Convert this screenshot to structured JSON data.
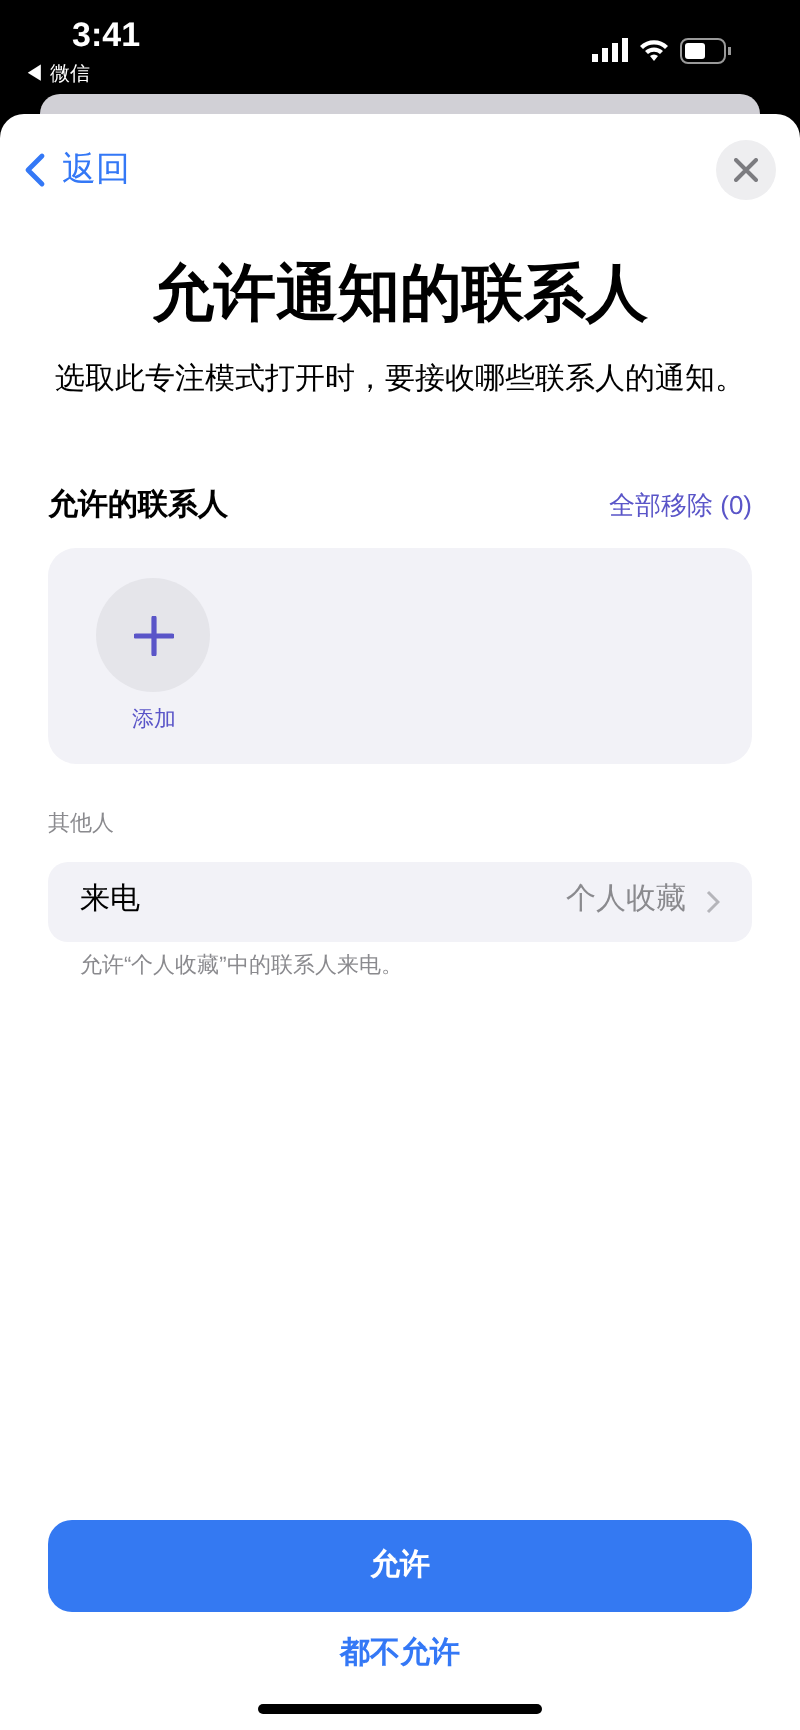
{
  "status_bar": {
    "time": "3:41",
    "back_app": "◀ 微信"
  },
  "nav": {
    "back": "返回"
  },
  "title": "允许通知的联系人",
  "subtitle": "选取此专注模式打开时，要接收哪些联系人的通知。",
  "allowed": {
    "header": "允许的联系人",
    "remove_all": "全部移除 (0)",
    "add_label": "添加"
  },
  "others": {
    "header": "其他人",
    "rows": [
      {
        "label": "来电",
        "value": "个人收藏"
      }
    ],
    "footnote": "允许“个人收藏”中的联系人来电。"
  },
  "buttons": {
    "primary": "允许",
    "secondary": "都不允许"
  }
}
